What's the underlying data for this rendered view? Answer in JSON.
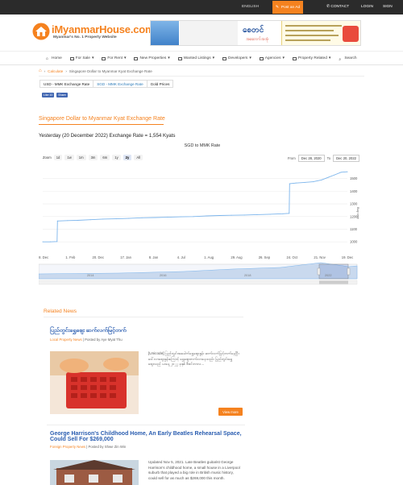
{
  "topbar": {
    "language": "ENGLISH",
    "post_label": "Post an Ad",
    "contact": "CONTACT",
    "login": "LOGIN",
    "register": "SIGN"
  },
  "logo": {
    "name_prefix": "i",
    "name": "MyanmarHouse.com",
    "tagline": "Myanmar's No. 1 Property Website"
  },
  "banner": {
    "brand": "စေတင်",
    "sub": "အဆောက်အအုံ"
  },
  "nav": [
    {
      "label": "Home",
      "icon": "home-icon"
    },
    {
      "label": "For Sale",
      "icon": "for-sale-icon",
      "dropdown": true
    },
    {
      "label": "For Rent",
      "icon": "for-rent-icon",
      "dropdown": true
    },
    {
      "label": "New Properties",
      "icon": "building-icon",
      "dropdown": true
    },
    {
      "label": "Wanted Listings",
      "icon": "list-icon",
      "dropdown": true
    },
    {
      "label": "Developers",
      "icon": "developer-icon",
      "dropdown": true
    },
    {
      "label": "Agencies",
      "icon": "agency-icon",
      "dropdown": true
    },
    {
      "label": "Property Related",
      "icon": "grid-icon",
      "dropdown": true
    },
    {
      "label": "Search",
      "icon": "search-icon"
    }
  ],
  "breadcrumb": {
    "calculate": "Calculate",
    "current": "Singapore Dollar to Myanmar Kyat Exchange Rate"
  },
  "tabs": [
    {
      "label": "USD - MMK Exchange Rate",
      "active": false
    },
    {
      "label": "SGD - MMK Exchange Rate",
      "active": true
    },
    {
      "label": "Gold Prices",
      "active": false
    }
  ],
  "social": {
    "like": "Like 10",
    "share": "Share"
  },
  "section_title": "Singapore Dollar to Myanmar Kyat Exchange Rate",
  "rate_line": "Yesterday (20 December 2022) Exchange Rate = 1,554 Kyats",
  "chart_ui": {
    "zoom_label": "Zoom",
    "zoom_buttons": [
      "1d",
      "1w",
      "1m",
      "3m",
      "6m",
      "1y",
      "2y",
      "All"
    ],
    "zoom_selected": "2y",
    "from_label": "From",
    "from_value": "Dec 28, 2020",
    "to_label": "To",
    "to_value": "Dec 20, 2022"
  },
  "chart_data": {
    "type": "line",
    "title": "SGD to MMK Rate",
    "ylabel": "Buy rate",
    "ylim": [
      950,
      1600
    ],
    "yticks": [
      1000,
      1100,
      1200,
      1300,
      1400,
      1500
    ],
    "xticks": [
      "28. Dec",
      "1. Feb",
      "20. Dec",
      "17. Jan",
      "8. Jan",
      "4. Jul",
      "1. Aug",
      "29. Aug",
      "26. Sep",
      "24. Oct",
      "21. Nov",
      "19. Dec"
    ],
    "series": [
      {
        "name": "",
        "color": "#7cb5ec",
        "x": [
          "2020-12-28",
          "2021-01-15",
          "2021-01-31",
          "2021-02-01",
          "2021-02-25",
          "2021-03-20",
          "2021-04-20",
          "2021-05-20",
          "2021-06-20",
          "2021-07-20",
          "2021-08-20",
          "2021-09-20",
          "2021-10-20",
          "2021-11-20",
          "2021-12-20",
          "2022-01-20",
          "2022-02-20",
          "2022-03-20",
          "2022-04-20",
          "2022-05-20",
          "2022-06-20",
          "2022-07-20",
          "2022-08-04",
          "2022-08-05",
          "2022-08-20",
          "2022-09-10",
          "2022-09-30",
          "2022-10-20",
          "2022-11-05",
          "2022-11-20",
          "2022-12-05",
          "2022-12-20"
        ],
        "values": [
          1000,
          1000,
          1002,
          1165,
          1168,
          1170,
          1175,
          1180,
          1182,
          1185,
          1190,
          1192,
          1195,
          1198,
          1200,
          1205,
          1208,
          1210,
          1212,
          1215,
          1218,
          1222,
          1225,
          1460,
          1465,
          1470,
          1475,
          1490,
          1510,
          1530,
          1550,
          1554
        ]
      }
    ],
    "navigator_years": [
      "2014",
      "2016",
      "2018",
      "2022"
    ]
  },
  "related": {
    "title": "Related News",
    "view_more": "View more",
    "articles": [
      {
        "title": "ပြည်တွင်းရွှေဈေး ဆက်လက်မြင့်တက်",
        "category": "Local Property News",
        "author": "| Posted by Aye Myat Thu",
        "excerpt": "[Unicode] ပြည်တွင်းအခေါက်ရွှေဈေးနှုန်း ဆက်လက်မြင့်တက်နေပြီး ဒေါ်လာဈေးနှုန်းကြောင့် ရွှေဈေးတက်လာနေသည်။ ပြည်တွင်းရွှေဈေးသည် ယနေ့ ၂၀၂၂ ခုနှစ် ဒီဇင်ဘာလ..."
      },
      {
        "title": "George Harrison's Childhood Home, An Early Beatles Rehearsal Space, Could Sell For $269,000",
        "category": "Foreign Property News",
        "author": "| Posted by Shwe Zin Win",
        "excerpt": "Updated Nov 5, 2021. Late Beatles guitarist George Harrison's childhood home, a small house in a Liverpool suburb that played a big role in British music history, could sell for as much as $269,000 this month."
      }
    ]
  }
}
